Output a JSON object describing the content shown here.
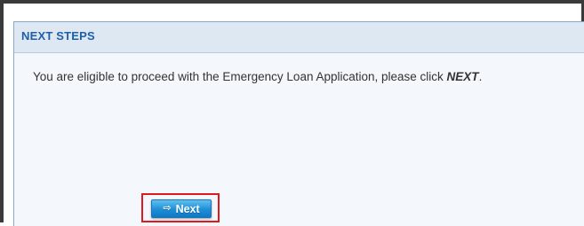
{
  "panel": {
    "title": "NEXT STEPS",
    "message_prefix": "You are eligible to proceed with the Emergency Loan Application, please click ",
    "message_emphasis": "NEXT",
    "message_suffix": "."
  },
  "actions": {
    "next_label": "Next",
    "next_icon": "arrow-right-icon"
  },
  "colors": {
    "title": "#1f5fa8",
    "button": "#1e8ed6",
    "highlight": "#e0191d"
  }
}
